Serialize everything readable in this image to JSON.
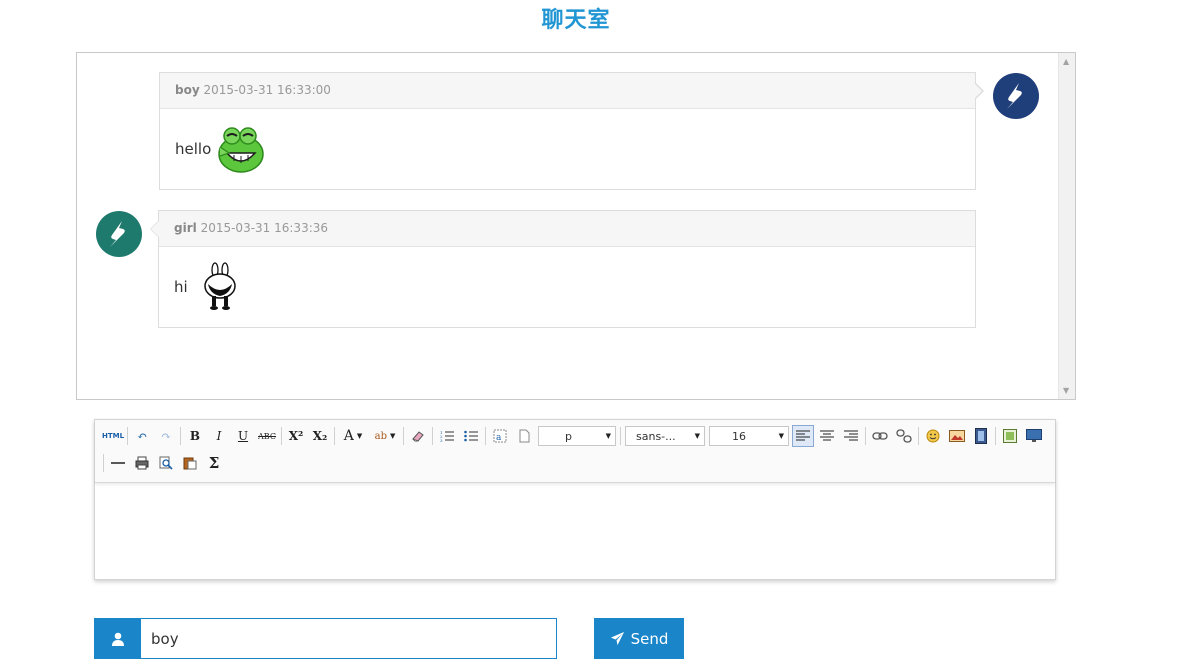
{
  "page": {
    "title": "聊天室"
  },
  "messages": [
    {
      "user": "boy",
      "time": "2015-03-31 16:33:00",
      "text": "hello",
      "emoji": "grinning-frog-emoji",
      "side": "right",
      "avatar_color": "#1f3f7a"
    },
    {
      "user": "girl",
      "time": "2015-03-31 16:33:36",
      "text": "hi",
      "emoji": "bunny-emoji",
      "side": "left",
      "avatar_color": "#1f7a6e"
    }
  ],
  "editor": {
    "toolbar": {
      "paragraph": "p",
      "font_family": "sans-...",
      "font_size": "16",
      "buttons_row1": [
        "html",
        "undo",
        "redo",
        "bold",
        "italic",
        "underline",
        "strikethrough",
        "superscript",
        "subscript",
        "font-color",
        "highlight",
        "eraser",
        "ordered-list",
        "unordered-list",
        "anchor",
        "page",
        "align-left",
        "align-center",
        "align-right",
        "link",
        "unlink",
        "emoticon",
        "image",
        "video",
        "map",
        "print-preview"
      ],
      "buttons_row2": [
        "horizontal-rule",
        "print",
        "preview",
        "paste",
        "formula"
      ]
    },
    "content": ""
  },
  "input": {
    "username": "boy"
  },
  "send": {
    "label": "Send"
  },
  "colors": {
    "accent": "#1a85c9",
    "title": "#2196d3"
  }
}
